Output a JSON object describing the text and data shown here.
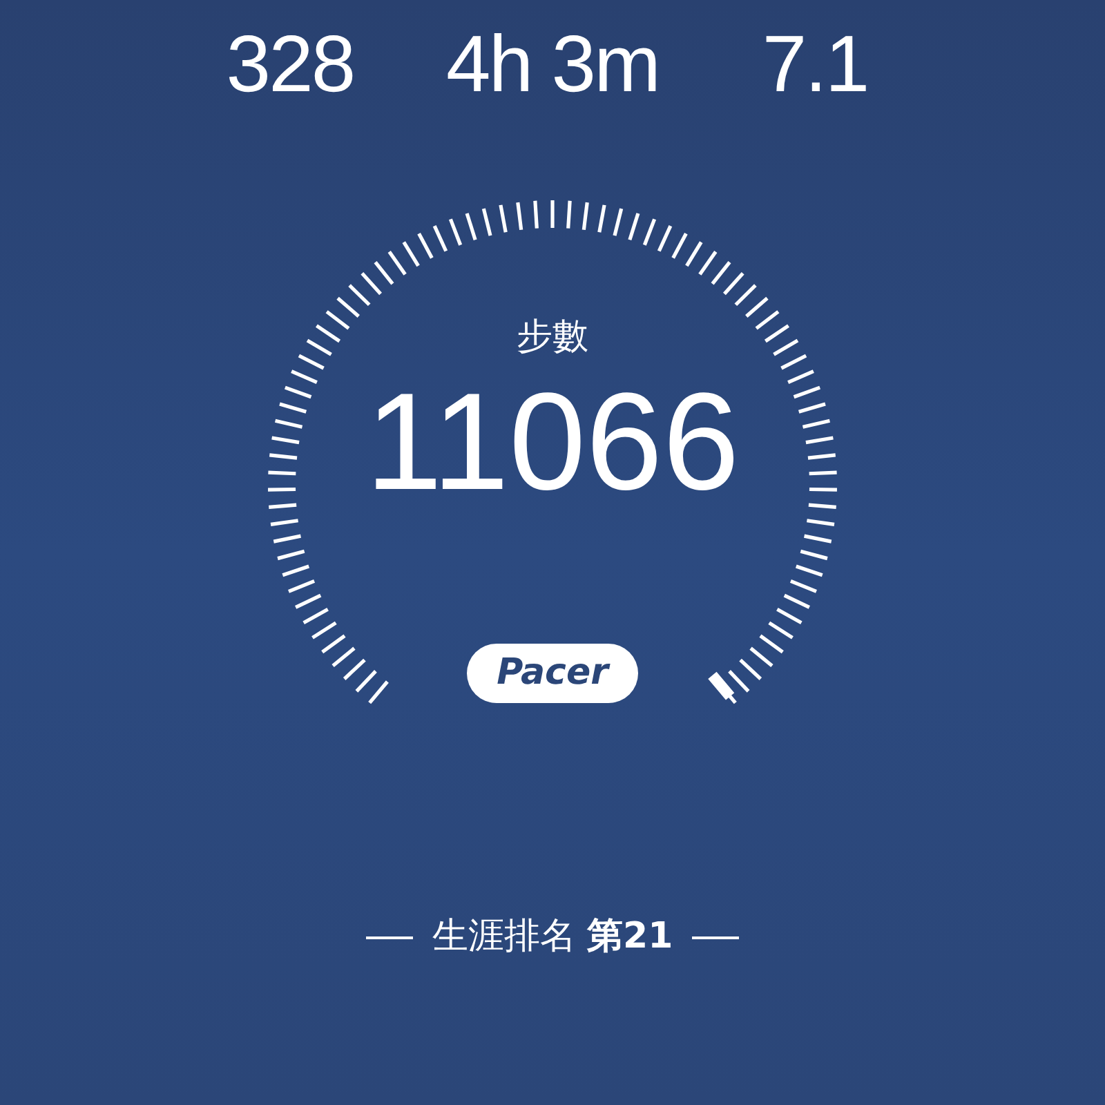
{
  "stats": [
    {
      "value": "328"
    },
    {
      "value": "4h 3m"
    },
    {
      "value": "7.1"
    }
  ],
  "gauge": {
    "label": "步數",
    "value": "11066"
  },
  "logo": {
    "text": "Pacer"
  },
  "rank": {
    "text": "生涯排名 **第21**"
  }
}
